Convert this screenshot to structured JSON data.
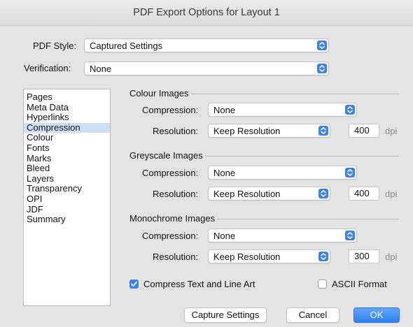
{
  "window": {
    "title": "PDF Export Options for Layout 1"
  },
  "pdf_style": {
    "label": "PDF Style:",
    "value": "Captured Settings"
  },
  "verification": {
    "label": "Verification:",
    "value": "None"
  },
  "sidebar": {
    "items": [
      "Pages",
      "Meta Data",
      "Hyperlinks",
      "Compression",
      "Colour",
      "Fonts",
      "Marks",
      "Bleed",
      "Layers",
      "Transparency",
      "OPI",
      "JDF",
      "Summary"
    ],
    "selected": "Compression"
  },
  "colour_images": {
    "title": "Colour Images",
    "compression_label": "Compression:",
    "compression": "None",
    "resolution_label": "Resolution:",
    "resolution": "Keep Resolution",
    "dpi_value": "400",
    "dpi_unit": "dpi"
  },
  "greyscale_images": {
    "title": "Greyscale Images",
    "compression_label": "Compression:",
    "compression": "None",
    "resolution_label": "Resolution:",
    "resolution": "Keep Resolution",
    "dpi_value": "400",
    "dpi_unit": "dpi"
  },
  "monochrome_images": {
    "title": "Monochrome Images",
    "compression_label": "Compression:",
    "compression": "None",
    "resolution_label": "Resolution:",
    "resolution": "Keep Resolution",
    "dpi_value": "300",
    "dpi_unit": "dpi"
  },
  "options": {
    "compress_text": {
      "label": "Compress Text and Line Art",
      "checked": true
    },
    "ascii_format": {
      "label": "ASCII Format",
      "checked": false
    }
  },
  "buttons": {
    "capture": "Capture Settings",
    "cancel": "Cancel",
    "ok": "OK"
  },
  "colors": {
    "accent": "#3b7ff5",
    "selection": "#cfdff5"
  },
  "icons": {
    "select_arrow": "chevron-up-down-icon",
    "check": "checkmark-icon"
  }
}
